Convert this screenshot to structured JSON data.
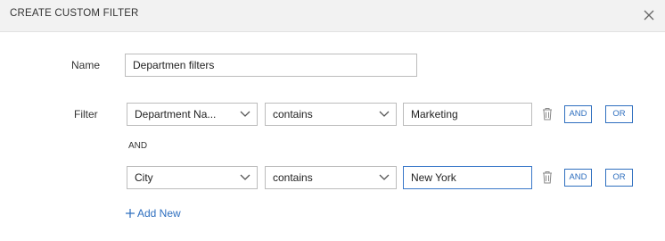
{
  "dialog": {
    "title": "CREATE CUSTOM FILTER",
    "close_icon": "close-icon"
  },
  "name_field": {
    "label": "Name",
    "value": "Departmen filters"
  },
  "filter": {
    "label": "Filter",
    "rows": [
      {
        "field": "Department Na...",
        "operator": "contains",
        "value": "Marketing",
        "and_label": "AND",
        "or_label": "OR"
      },
      {
        "field": "City",
        "operator": "contains",
        "value": "New York",
        "and_label": "AND",
        "or_label": "OR"
      }
    ],
    "connector": "AND",
    "add_new_label": "Add New"
  },
  "colors": {
    "accent": "#2f6fbf",
    "focus_border": "#3a78c9",
    "header_bg": "#f2f2f2"
  }
}
